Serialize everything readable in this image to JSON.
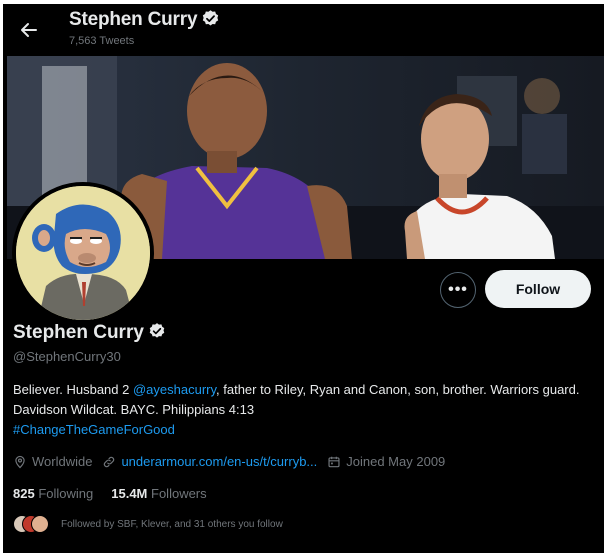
{
  "header": {
    "name": "Stephen Curry",
    "tweets_count": "7,563 Tweets"
  },
  "profile": {
    "display_name": "Stephen Curry",
    "handle": "@StephenCurry30",
    "follow_label": "Follow",
    "more_label": "•••",
    "bio": {
      "part1": "Believer. Husband 2 ",
      "mention": "@ayeshacurry",
      "part2": ", father to Riley, Ryan and Canon, son, brother. Warriors guard. Davidson Wildcat. BAYC. Philippians 4:13",
      "hashtag": "#ChangeTheGameForGood"
    },
    "location": "Worldwide",
    "website": "underarmour.com/en-us/t/curryb...",
    "joined": "Joined May 2009",
    "following_count": "825",
    "following_label": "Following",
    "followers_count": "15.4M",
    "followers_label": "Followers",
    "followed_by": "Followed by SBF, Klever, and 31 others you follow"
  },
  "colors": {
    "background": "#000000",
    "accent": "#1d9bf0",
    "text_primary": "#e7e9ea",
    "text_secondary": "#71767b",
    "verified": "#e7e9ea"
  },
  "icons": {
    "back": "arrow-left-icon",
    "verified": "verified-badge-icon",
    "location": "location-pin-icon",
    "link": "link-icon",
    "calendar": "calendar-icon"
  }
}
